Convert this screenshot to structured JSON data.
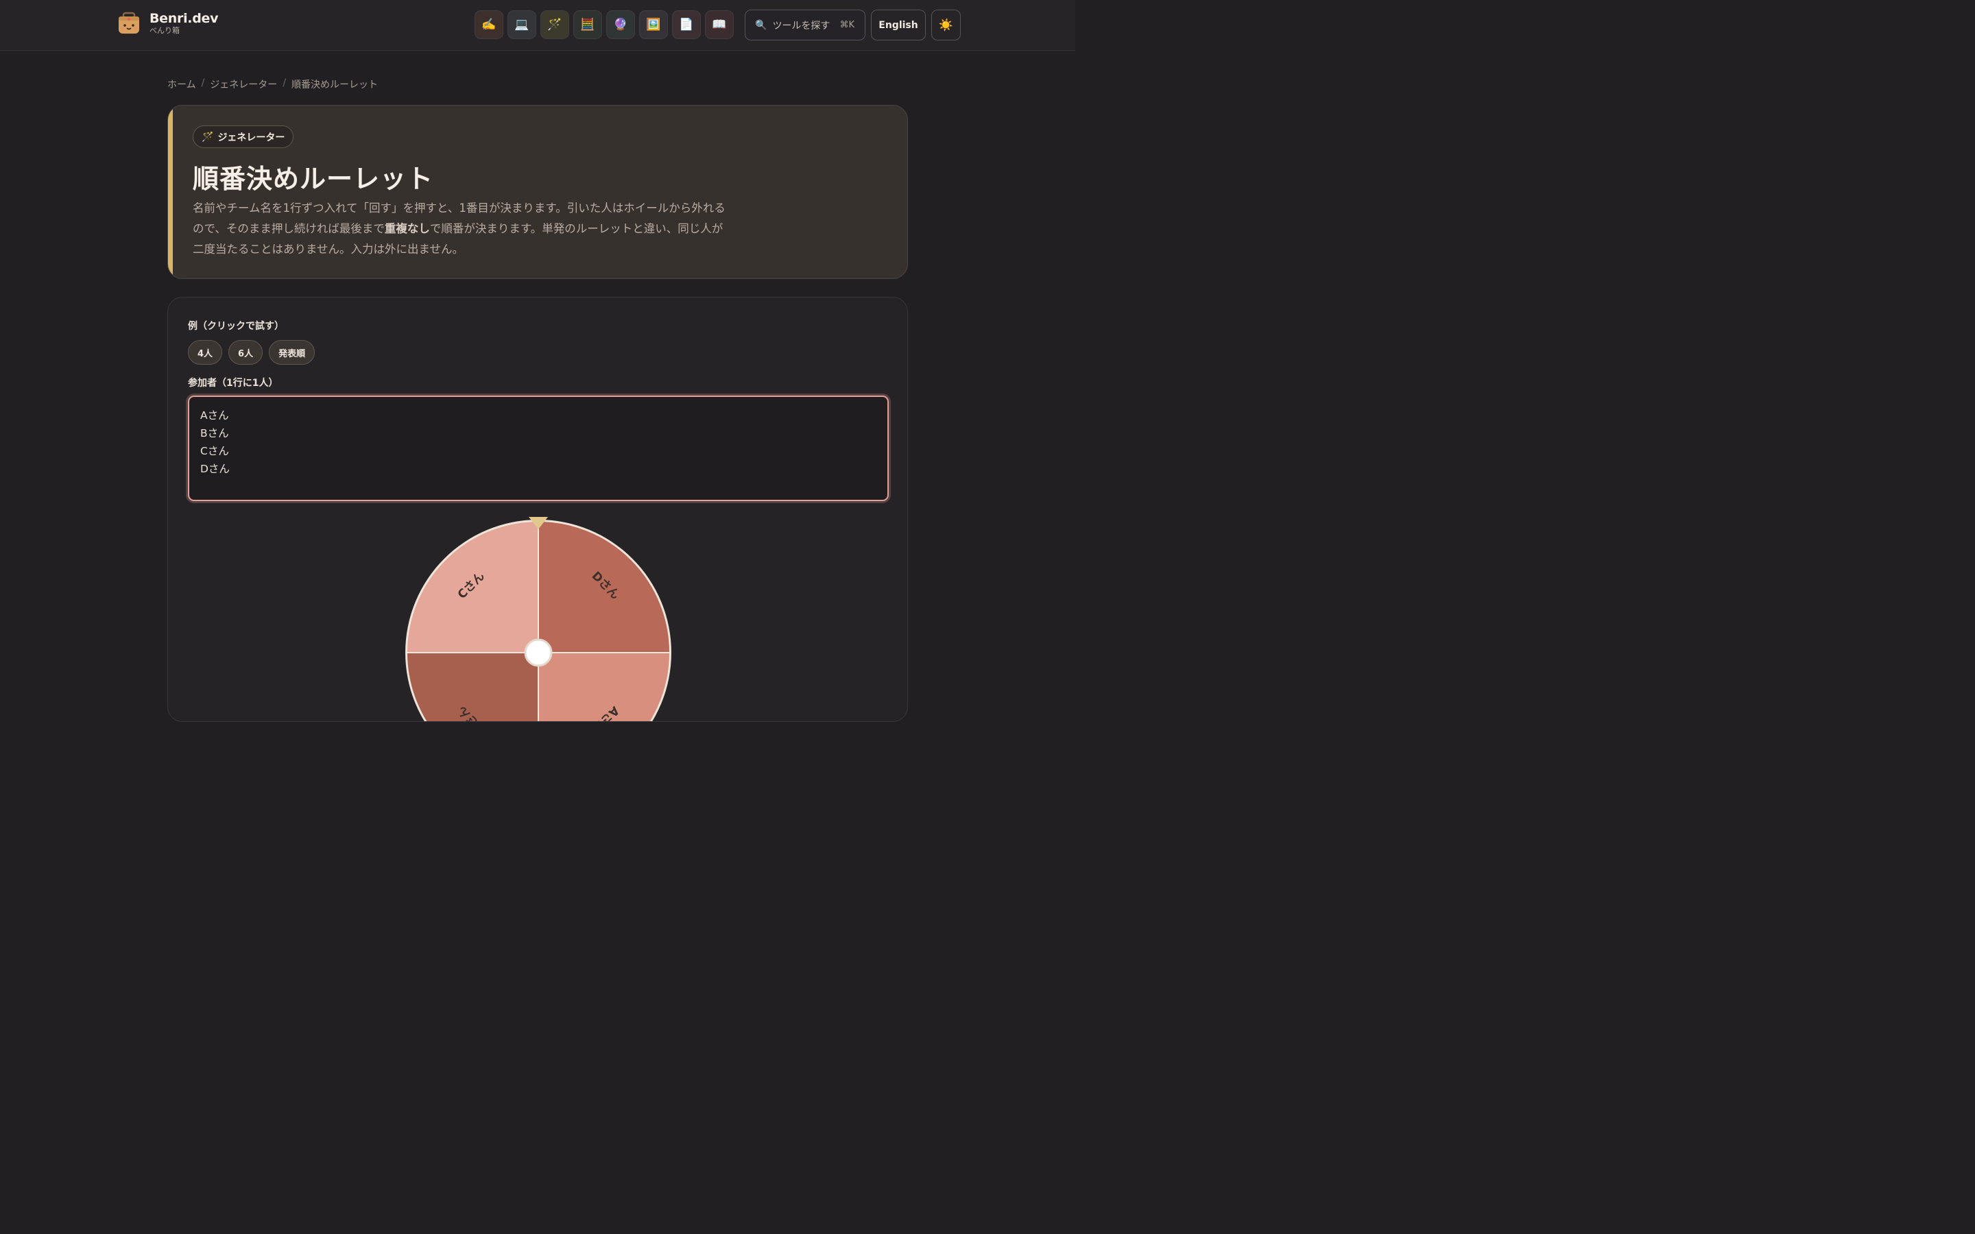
{
  "header": {
    "brand_name": "Benri.dev",
    "brand_sub": "べんり箱",
    "categories": [
      {
        "icon": "✍️",
        "name": "writing-icon",
        "bg": "#3d302c"
      },
      {
        "icon": "💻",
        "name": "laptop-icon",
        "bg": "#343539"
      },
      {
        "icon": "🪄",
        "name": "magic-wand-icon",
        "bg": "#3b3a2c"
      },
      {
        "icon": "🧮",
        "name": "abacus-icon",
        "bg": "#2e3330"
      },
      {
        "icon": "🔮",
        "name": "crystal-ball-icon",
        "bg": "#2f3434"
      },
      {
        "icon": "🖼️",
        "name": "picture-icon",
        "bg": "#343137"
      },
      {
        "icon": "📄",
        "name": "document-icon",
        "bg": "#3b2f31"
      },
      {
        "icon": "📖",
        "name": "book-icon",
        "bg": "#3b2d2f"
      }
    ],
    "search_label": "ツールを探す",
    "search_shortcut": "⌘K",
    "language_label": "English",
    "theme_icon": "☀️"
  },
  "breadcrumb": {
    "home": "ホーム",
    "category": "ジェネレーター",
    "current": "順番決めルーレット"
  },
  "hero": {
    "chip_icon": "🪄",
    "chip_label": "ジェネレーター",
    "title": "順番決めルーレット",
    "desc_before": "名前やチーム名を1行ずつ入れて「回す」を押すと、1番目が決まります。引いた人はホイールから外れるので、そのまま押し続ければ最後まで",
    "desc_bold": "重複なし",
    "desc_after": "で順番が決まります。単発のルーレットと違い、同じ人が二度当たることはありません。入力は外に出ません。",
    "accent_color": "#d8b564"
  },
  "examples": {
    "label": "例（クリックで試す）",
    "buttons": [
      "4人",
      "6人",
      "発表順"
    ]
  },
  "participants": {
    "label": "参加者（1行に1人）",
    "value": "Aさん\nBさん\nCさん\nDさん"
  },
  "wheel": {
    "segments": [
      {
        "label": "Aさん",
        "color": "#d98f7e"
      },
      {
        "label": "Bさん",
        "color": "#a8604e"
      },
      {
        "label": "Cさん",
        "color": "#e4a79a"
      },
      {
        "label": "Dさん",
        "color": "#b96958"
      }
    ],
    "pointer_color": "#e0c98a"
  }
}
